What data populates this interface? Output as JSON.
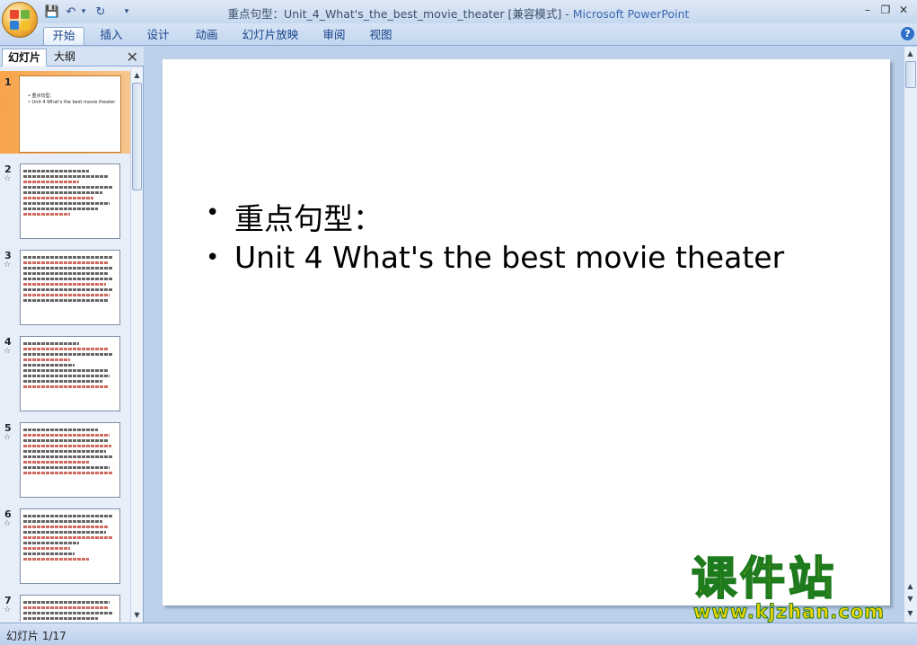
{
  "window": {
    "title_doc": "重点句型：Unit_4_What's_the_best_movie_theater [兼容模式] - ",
    "title_app": "Microsoft PowerPoint",
    "minimize": "–",
    "restore": "❐",
    "close": "✕"
  },
  "quick_access": {
    "save": "💾",
    "undo": "↶",
    "undo_drop": "▾",
    "redo": "↻",
    "customize": "▾"
  },
  "ribbon": {
    "tabs": [
      {
        "label": "开始",
        "active": true
      },
      {
        "label": "插入"
      },
      {
        "label": "设计"
      },
      {
        "label": "动画"
      },
      {
        "label": "幻灯片放映"
      },
      {
        "label": "审阅"
      },
      {
        "label": "视图"
      }
    ],
    "help": "?"
  },
  "panel": {
    "tab_slides": "幻灯片",
    "tab_outline": "大纲",
    "close": "✕",
    "thumbnails": [
      {
        "num": "1",
        "anim": "",
        "lines": [
          "• 重点句型：",
          "• Unit 4 What's the best movie theater"
        ]
      },
      {
        "num": "2",
        "anim": "☆"
      },
      {
        "num": "3",
        "anim": "☆"
      },
      {
        "num": "4",
        "anim": "☆"
      },
      {
        "num": "5",
        "anim": "☆"
      },
      {
        "num": "6",
        "anim": "☆"
      },
      {
        "num": "7",
        "anim": "☆"
      }
    ]
  },
  "slide": {
    "bullets": [
      "重点句型：",
      "Unit 4 What's the best movie theater"
    ],
    "bullet_char": "•"
  },
  "status": {
    "text": "幻灯片 1/17"
  },
  "watermark": {
    "main": "课件站",
    "url": "www.kjzhan.com"
  },
  "colors": {
    "accent": "#f4a64c",
    "ribbon": "#c3d6ef"
  }
}
